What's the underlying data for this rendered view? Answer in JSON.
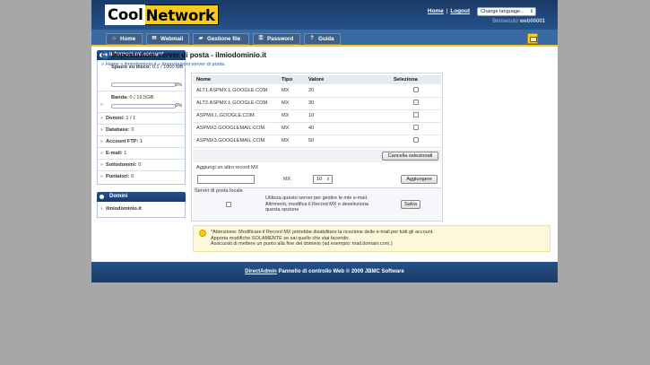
{
  "header": {
    "logo_part1": "Cool",
    "logo_part2": "Network",
    "home_link": "Home",
    "separator": "|",
    "logout_link": "Logout",
    "language_select": "Change language...",
    "welcome_label": "Benvenuto",
    "username": "web00001"
  },
  "nav": {
    "tabs": [
      {
        "label": "Home",
        "icon": "home-icon"
      },
      {
        "label": "Webmail",
        "icon": "mail-icon"
      },
      {
        "label": "Gestione file",
        "icon": "folder-icon"
      },
      {
        "label": "Password",
        "icon": "key-icon"
      },
      {
        "label": "Guida",
        "icon": "help-icon"
      }
    ]
  },
  "sidebar": {
    "account_title": "Informazioni account",
    "disk_label": "Spazio su disco:",
    "disk_value": "0.1 / 1000 MB",
    "disk_pct": "0%",
    "disk_fraction": 0.0,
    "bandwidth_label": "Banda:",
    "bandwidth_value": "0 / 19.5GB",
    "bandwidth_pct": "0%",
    "bandwidth_fraction": 0.0,
    "stats": [
      {
        "label": "Domini:",
        "value": "1 / 1"
      },
      {
        "label": "Database:",
        "value": "0"
      },
      {
        "label": "Account FTP:",
        "value": "1"
      },
      {
        "label": "E-mail:",
        "value": "1"
      },
      {
        "label": "Sottodomini:",
        "value": "0"
      },
      {
        "label": "Puntatori:",
        "value": "0"
      }
    ],
    "domains_title": "Domini",
    "domains": [
      "ilmiodominio.it"
    ]
  },
  "main": {
    "title": "Impostazioni server di posta - ilmiodominio.it",
    "breadcrumb": [
      "Home",
      "ilmiodominio.it",
      "Impostazioni server di posta"
    ],
    "breadcrumb_sep": "»",
    "table": {
      "columns": [
        "Nome",
        "Tipo",
        "Valore",
        "Seleziona"
      ],
      "rows": [
        {
          "name": "ALT1.ASPMX.L.GOOGLE.COM.",
          "type": "MX",
          "value": "20"
        },
        {
          "name": "ALT2.ASPMX.L.GOOGLE.COM.",
          "type": "MX",
          "value": "30"
        },
        {
          "name": "ASPMX.L.GOOGLE.COM.",
          "type": "MX",
          "value": "10"
        },
        {
          "name": "ASPMX2.GOOGLEMAIL.COM.",
          "type": "MX",
          "value": "40"
        },
        {
          "name": "ASPMX3.GOOGLEMAIL.COM.",
          "type": "MX",
          "value": "50"
        }
      ]
    },
    "delete_button": "Cancella selezionati",
    "add_record_label": "Aggiungi un altro record MX",
    "add_record_type": "MX",
    "add_record_priority": "10",
    "add_button": "Aggiungere",
    "local_server_label": "Server di posta locale",
    "local_server_text": "Utilizza questo server per gestire le mie e-mail. Altrimenti, modifica il Record MX e deseleziona questa opzione",
    "save_button": "Salva",
    "notice_lines": [
      "*Attenzione: Modificare il Record MX potrebbe disabilitare la ricezione delle e-mail per tutti gli account.",
      "Apporta modifiche SOLAMENTE se sai quello che stai facendo.",
      "Assicurati di mettere un punto alla fine del dominio (ad esempio: mail.domain.com.)"
    ]
  },
  "footer": {
    "link": "DirectAdmin",
    "text": "Pannello di controllo Web © 2009 JBMC Software"
  }
}
